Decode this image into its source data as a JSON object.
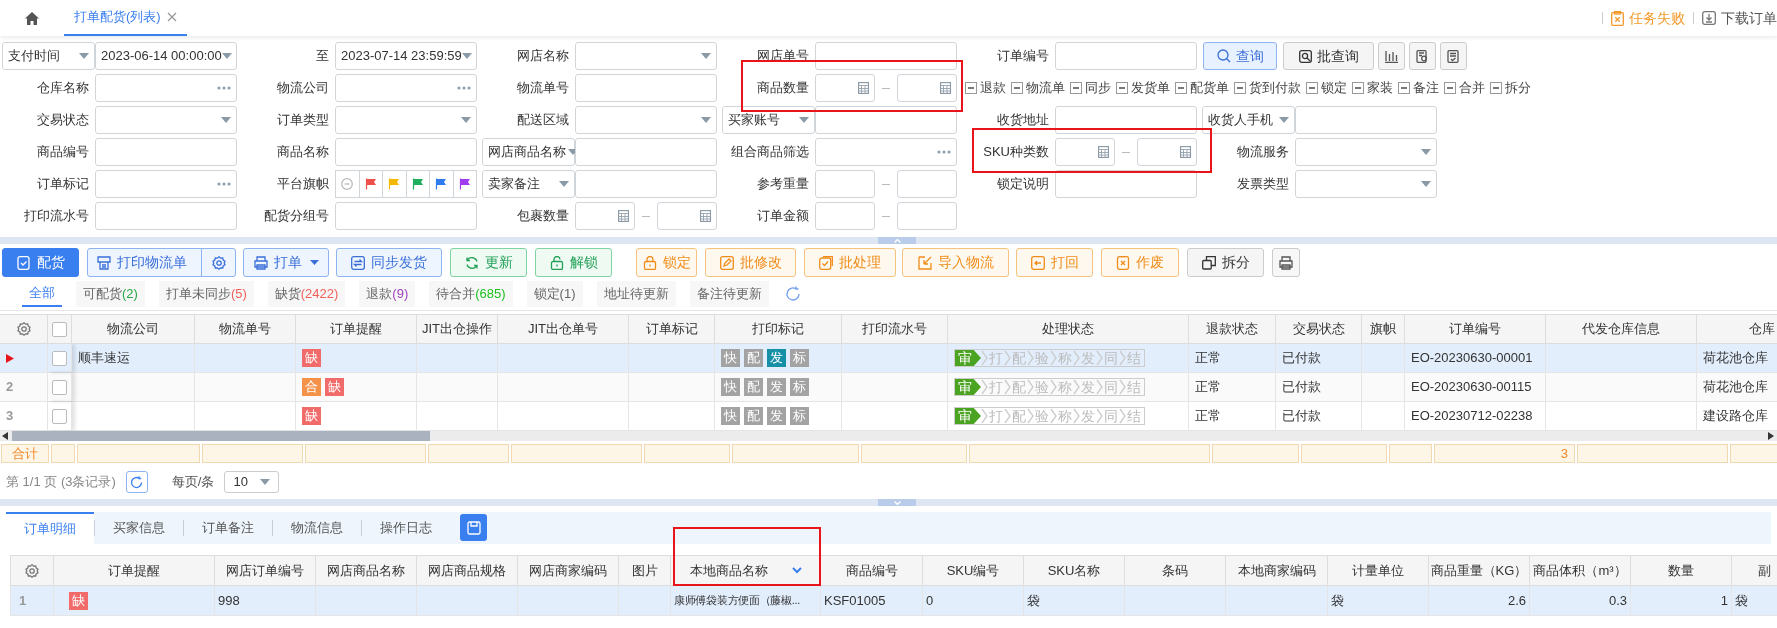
{
  "top_bar": {
    "tabs": [
      {
        "label": "打单配货(列表)",
        "selected": true
      }
    ],
    "actions": [
      {
        "label": "任务失败",
        "kind": "alert"
      },
      {
        "label": "下载订单",
        "kind": "download"
      }
    ]
  },
  "filters": {
    "lines": [
      {
        "fields": [
          {
            "label": "支付时间",
            "label_dropdown": true,
            "kind": "datetime",
            "value": "2023-06-14 00:00:00"
          },
          {
            "label": "至",
            "label_dropdown": false,
            "kind": "datetime",
            "value": "2023-07-14 23:59:59"
          },
          {
            "label": "网店名称",
            "label_dropdown": false,
            "kind": "select"
          },
          {
            "label": "网店单号",
            "label_dropdown": false,
            "kind": "input"
          },
          {
            "label": "订单编号",
            "label_dropdown": false,
            "kind": "input"
          }
        ]
      },
      {
        "fields": [
          {
            "label": "仓库名称",
            "label_dropdown": false,
            "kind": "picker"
          },
          {
            "label": "物流公司",
            "label_dropdown": false,
            "kind": "picker"
          },
          {
            "label": "物流单号",
            "label_dropdown": false,
            "kind": "input"
          },
          {
            "label": "商品数量",
            "label_dropdown": false,
            "kind": "range"
          }
        ]
      },
      {
        "fields": [
          {
            "label": "交易状态",
            "label_dropdown": false,
            "kind": "select"
          },
          {
            "label": "订单类型",
            "label_dropdown": false,
            "kind": "select"
          },
          {
            "label": "配送区域",
            "label_dropdown": false,
            "kind": "select"
          },
          {
            "label": "买家账号",
            "label_dropdown": true,
            "kind": "input"
          },
          {
            "label": "收货地址",
            "label_dropdown": false,
            "kind": "input"
          },
          {
            "label": "收货人手机",
            "label_dropdown": true,
            "kind": "input"
          }
        ]
      },
      {
        "fields": [
          {
            "label": "商品编号",
            "label_dropdown": false,
            "kind": "input"
          },
          {
            "label": "商品名称",
            "label_dropdown": false,
            "kind": "input"
          },
          {
            "label": "网店商品名称",
            "label_dropdown": true,
            "kind": "input"
          },
          {
            "label": "组合商品筛选",
            "label_dropdown": false,
            "kind": "picker"
          },
          {
            "label": "SKU种类数",
            "label_dropdown": false,
            "kind": "range"
          },
          {
            "label": "物流服务",
            "label_dropdown": false,
            "kind": "select"
          }
        ]
      },
      {
        "fields": [
          {
            "label": "订单标记",
            "label_dropdown": false,
            "kind": "picker"
          },
          {
            "label": "平台旗帜",
            "label_dropdown": false,
            "kind": "flags",
            "flags": [
              {
                "kind": "clear"
              },
              {
                "kind": "flag",
                "color": "#f0504a"
              },
              {
                "kind": "flag",
                "color": "#f5b800"
              },
              {
                "kind": "flag",
                "color": "#1fae5b"
              },
              {
                "kind": "flag",
                "color": "#2f7cf0"
              },
              {
                "kind": "flag",
                "color": "#a23bf0"
              }
            ]
          },
          {
            "label": "卖家备注",
            "label_dropdown": true,
            "kind": "input"
          },
          {
            "label": "参考重量",
            "label_dropdown": false,
            "kind": "range_plain"
          },
          {
            "label": "锁定说明",
            "label_dropdown": false,
            "kind": "input"
          },
          {
            "label": "发票类型",
            "label_dropdown": false,
            "kind": "select"
          }
        ]
      },
      {
        "fields": [
          {
            "label": "打印流水号",
            "label_dropdown": false,
            "kind": "input"
          },
          {
            "label": "配货分组号",
            "label_dropdown": false,
            "kind": "input"
          },
          {
            "label": "包裹数量",
            "label_dropdown": false,
            "kind": "range"
          },
          {
            "label": "订单金额",
            "label_dropdown": false,
            "kind": "range_plain"
          }
        ]
      }
    ],
    "buttons": [
      {
        "label": "查询",
        "kind": "primary"
      },
      {
        "label": "批查询",
        "kind": "default"
      }
    ],
    "checkboxes": [
      {
        "label": "退款",
        "indeterminate": true
      },
      {
        "label": "物流单",
        "indeterminate": true
      },
      {
        "label": "同步",
        "indeterminate": true
      },
      {
        "label": "发货单",
        "indeterminate": true
      },
      {
        "label": "配货单",
        "indeterminate": true
      },
      {
        "label": "货到付款",
        "indeterminate": true
      },
      {
        "label": "锁定",
        "indeterminate": true
      },
      {
        "label": "家装",
        "indeterminate": true
      },
      {
        "label": "备注",
        "indeterminate": true
      },
      {
        "label": "合并",
        "indeterminate": true
      },
      {
        "label": "拆分",
        "indeterminate": true
      }
    ]
  },
  "toolbar": [
    {
      "label": "配货",
      "kind": "solid"
    },
    {
      "label": "打印物流单",
      "kind": "split"
    },
    {
      "label": "打单",
      "kind": "menu"
    },
    {
      "label": "同步发货",
      "kind": "blue"
    },
    {
      "label": "更新",
      "kind": "green"
    },
    {
      "label": "解锁",
      "kind": "green"
    },
    {
      "label": "锁定",
      "kind": "orange"
    },
    {
      "label": "批修改",
      "kind": "orange"
    },
    {
      "label": "批处理",
      "kind": "orange"
    },
    {
      "label": "导入物流",
      "kind": "orange"
    },
    {
      "label": "打回",
      "kind": "orange"
    },
    {
      "label": "作废",
      "kind": "orange"
    },
    {
      "label": "拆分",
      "kind": "gray"
    }
  ],
  "status_tabs": [
    {
      "label": "全部",
      "selected": true
    },
    {
      "label": "可配货",
      "count": "(2)",
      "color": "#27a844",
      "selected": false
    },
    {
      "label": "打单未同步",
      "count": "(5)",
      "color": "#f0605a",
      "selected": false
    },
    {
      "label": "缺货",
      "count": "(2422)",
      "color": "#f0605a",
      "selected": false
    },
    {
      "label": "退款",
      "count": "(9)",
      "color": "#a040c0",
      "selected": false
    },
    {
      "label": "待合并",
      "count": "(685)",
      "color": "#1cc020",
      "selected": false
    },
    {
      "label": "锁定",
      "count": "(1)",
      "color": "#666666",
      "selected": false
    },
    {
      "label": "地址待更新",
      "selected": false
    },
    {
      "label": "备注待更新",
      "selected": false
    }
  ],
  "orders": {
    "columns": [
      "物流公司",
      "物流单号",
      "订单提醒",
      "JIT出仓操作",
      "JIT出仓单号",
      "订单标记",
      "打印标记",
      "打印流水号",
      "处理状态",
      "退款状态",
      "交易状态",
      "旗帜",
      "订单编号",
      "代发仓库信息",
      "仓库"
    ],
    "select_all": false,
    "rows": [
      {
        "current": true,
        "checked": false,
        "carrier": "顺丰速运",
        "reminders": [
          {
            "label": "缺",
            "color": "#f26b6b"
          }
        ],
        "print_marks": [
          {
            "label": "快",
            "on": false
          },
          {
            "label": "配",
            "on": false
          },
          {
            "label": "发",
            "on": true
          },
          {
            "label": "标",
            "on": false
          }
        ],
        "steps": [
          {
            "label": "审",
            "done": true
          },
          {
            "label": "打",
            "done": false
          },
          {
            "label": "配",
            "done": false
          },
          {
            "label": "验",
            "done": false
          },
          {
            "label": "称",
            "done": false
          },
          {
            "label": "发",
            "done": false
          },
          {
            "label": "同",
            "done": false
          },
          {
            "label": "结",
            "done": false
          }
        ],
        "refund_status": "正常",
        "trade_status": "已付款",
        "order_no": "EO-20230630-00001",
        "warehouse": "荷花池仓库"
      },
      {
        "current": false,
        "number": "2",
        "checked": false,
        "reminders": [
          {
            "label": "合",
            "color": "#f5924a"
          },
          {
            "label": "缺",
            "color": "#f26b6b"
          }
        ],
        "print_marks": [
          {
            "label": "快",
            "on": false
          },
          {
            "label": "配",
            "on": false
          },
          {
            "label": "发",
            "on": false
          },
          {
            "label": "标",
            "on": false
          }
        ],
        "steps": [
          {
            "label": "审",
            "done": true
          },
          {
            "label": "打",
            "done": false
          },
          {
            "label": "配",
            "done": false
          },
          {
            "label": "验",
            "done": false
          },
          {
            "label": "称",
            "done": false
          },
          {
            "label": "发",
            "done": false
          },
          {
            "label": "同",
            "done": false
          },
          {
            "label": "结",
            "done": false
          }
        ],
        "refund_status": "正常",
        "trade_status": "已付款",
        "order_no": "EO-20230630-00115",
        "warehouse": "荷花池仓库"
      },
      {
        "current": false,
        "number": "3",
        "checked": false,
        "reminders": [
          {
            "label": "缺",
            "color": "#f26b6b"
          }
        ],
        "print_marks": [
          {
            "label": "快",
            "on": false
          },
          {
            "label": "配",
            "on": false
          },
          {
            "label": "发",
            "on": false
          },
          {
            "label": "标",
            "on": false
          }
        ],
        "steps": [
          {
            "label": "审",
            "done": true
          },
          {
            "label": "打",
            "done": false
          },
          {
            "label": "配",
            "done": false
          },
          {
            "label": "验",
            "done": false
          },
          {
            "label": "称",
            "done": false
          },
          {
            "label": "发",
            "done": false
          },
          {
            "label": "同",
            "done": false
          },
          {
            "label": "结",
            "done": false
          }
        ],
        "refund_status": "正常",
        "trade_status": "已付款",
        "order_no": "EO-20230712-02238",
        "warehouse": "建设路仓库"
      }
    ],
    "totals": {
      "label": "合计",
      "order_count": "3"
    }
  },
  "pagination": {
    "summary": "第 1/1 页 (3条记录)",
    "page_size_label": "每页/条",
    "page_size": "10"
  },
  "detail": {
    "tabs": [
      {
        "label": "订单明细",
        "selected": true
      },
      {
        "label": "买家信息",
        "selected": false
      },
      {
        "label": "订单备注",
        "selected": false
      },
      {
        "label": "物流信息",
        "selected": false
      },
      {
        "label": "操作日志",
        "selected": false
      }
    ],
    "columns": [
      "订单提醒",
      "网店订单编号",
      "网店商品名称",
      "网店商品规格",
      "网店商家编码",
      "图片",
      "本地商品名称",
      "商品编号",
      "SKU编号",
      "SKU名称",
      "条码",
      "本地商家编码",
      "计量单位",
      "商品重量（KG）",
      "商品体积（m³）",
      "数量",
      "副"
    ],
    "rows": [
      {
        "number": "1",
        "selected": true,
        "reminder": {
          "label": "缺",
          "color": "#f26b6b"
        },
        "shop_order_no": "998",
        "local_product_name": "康师傅袋装方便面（藤椒...",
        "product_code": "KSF01005",
        "sku_code": "0",
        "sku_name": "袋",
        "unit": "袋",
        "weight": "2.6",
        "volume": "0.3",
        "quantity": "1",
        "column_17": "袋"
      }
    ]
  }
}
